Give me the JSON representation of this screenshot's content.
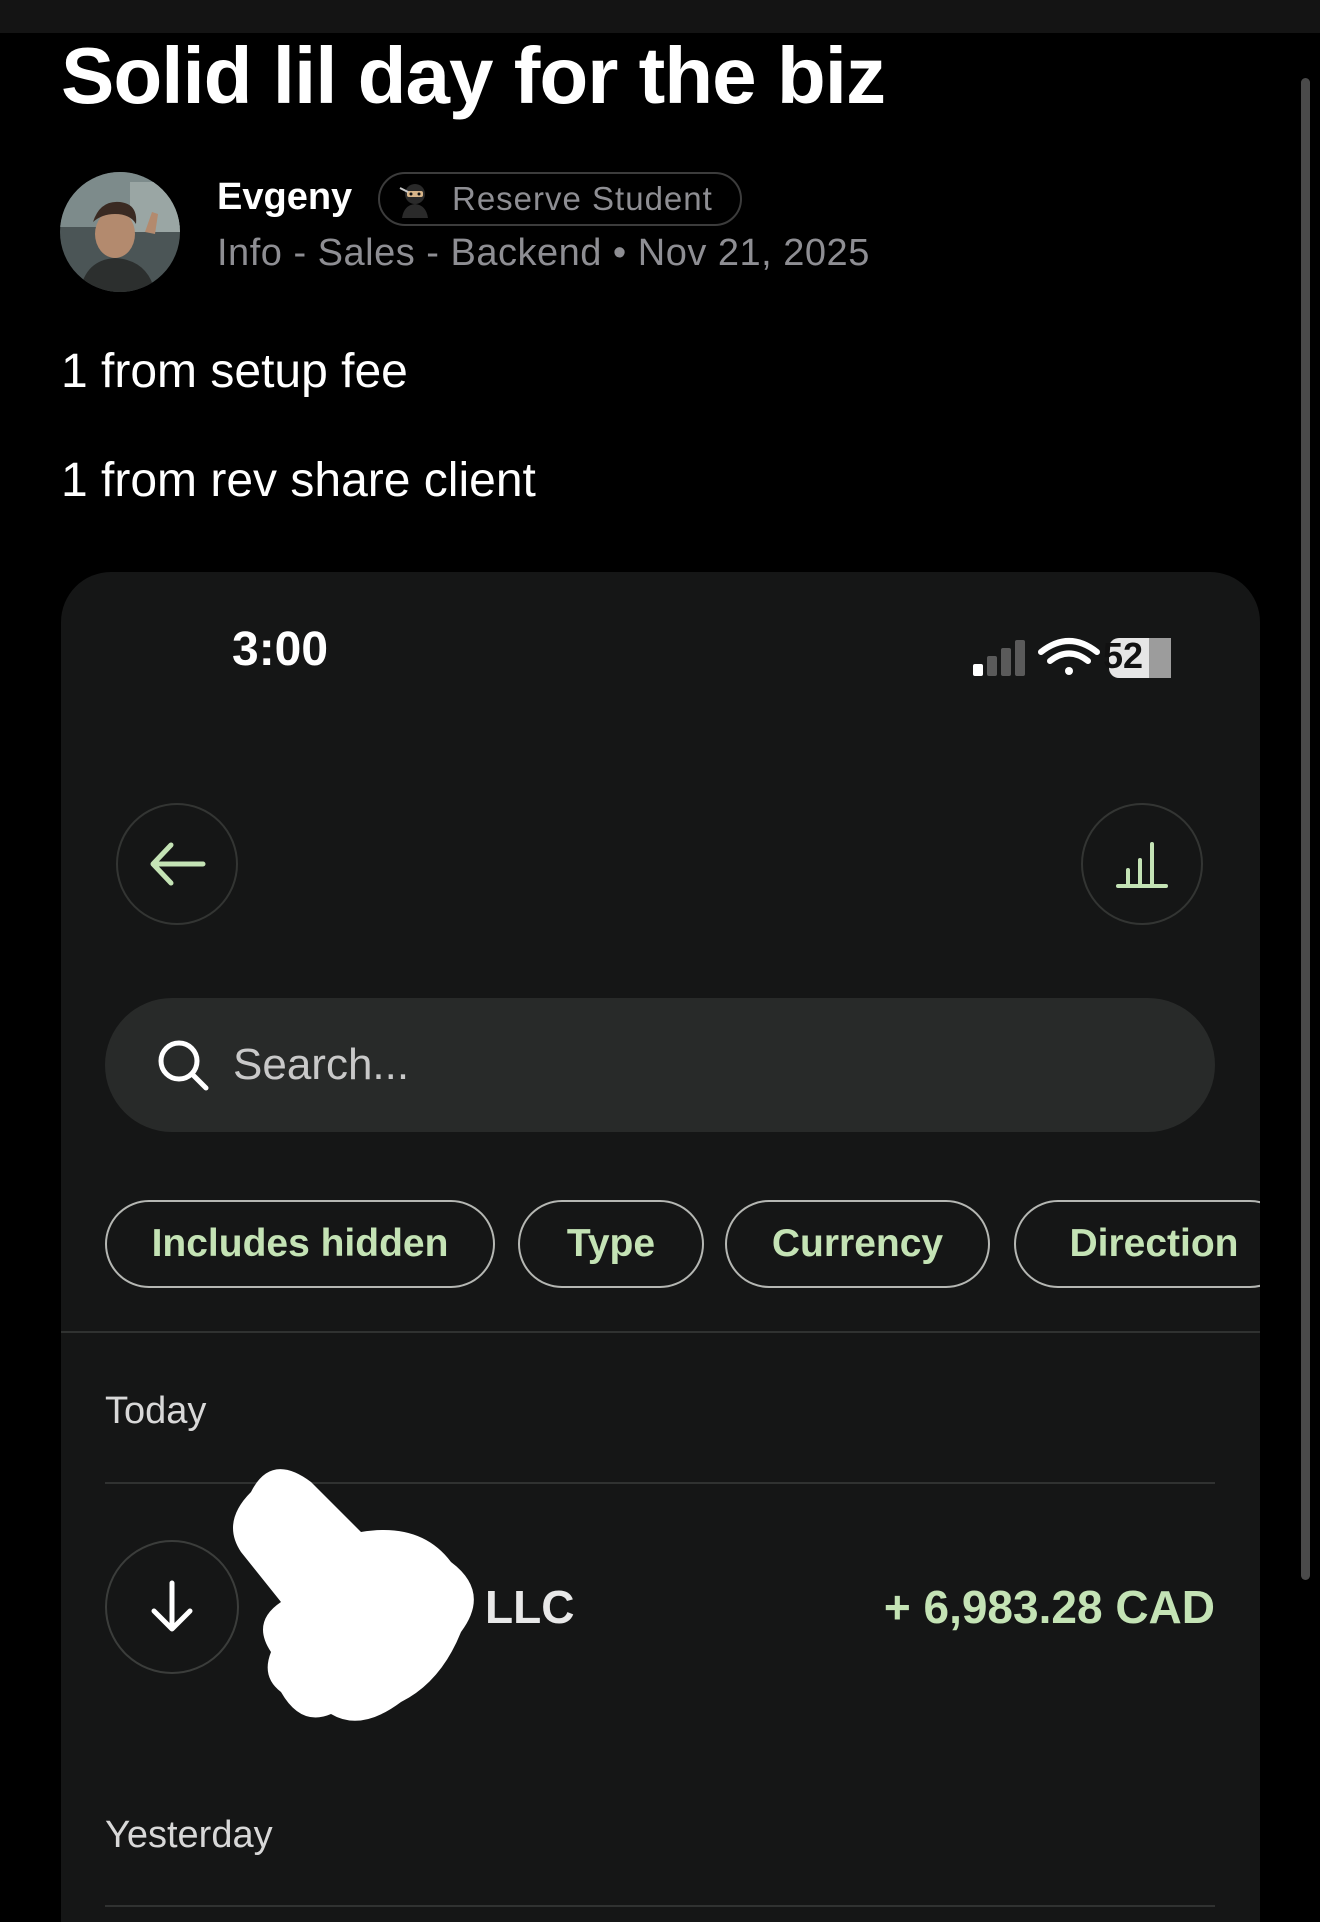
{
  "post": {
    "title": "Solid lil day for the biz",
    "author": {
      "name": "Evgeny",
      "badge_label": "Reserve Student",
      "meta": "Info - Sales - Backend • Nov 21, 2025"
    },
    "body_lines": [
      "1 from setup fee",
      "1 from rev share client"
    ]
  },
  "screenshot": {
    "status": {
      "time": "3:00",
      "battery": "52"
    },
    "search": {
      "placeholder": "Search..."
    },
    "filters": [
      "Includes hidden",
      "Type",
      "Currency",
      "Direction"
    ],
    "sections": {
      "today": "Today",
      "yesterday": "Yesterday"
    },
    "transaction": {
      "name": "LLC",
      "amount": "+ 6,983.28 CAD",
      "direction_icon": "arrow-down-icon"
    }
  },
  "colors": {
    "accent_green": "#c4e3b5",
    "muted_gray": "#8e8e93",
    "phone_bg": "#151616"
  }
}
